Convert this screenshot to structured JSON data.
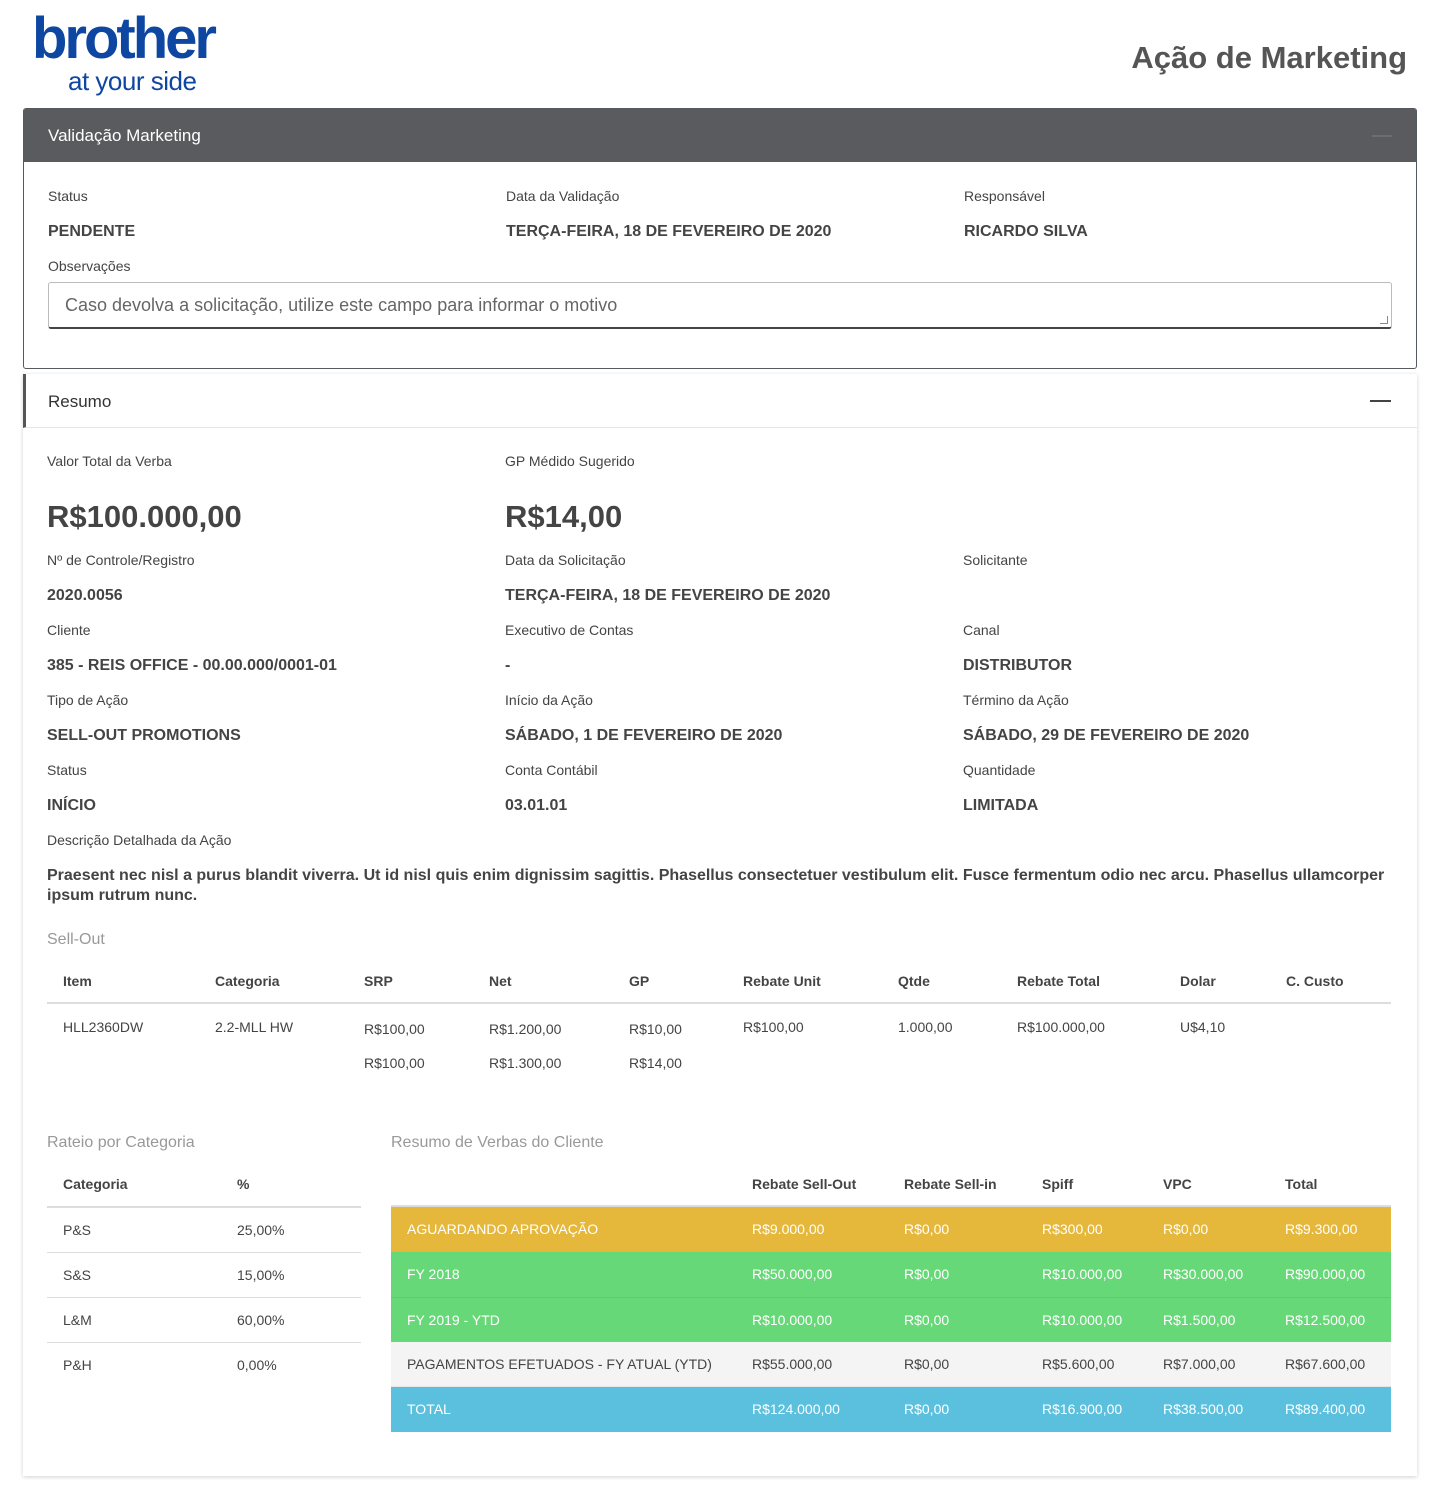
{
  "header": {
    "logo_word": "brother",
    "logo_tagline": "at your side",
    "page_title": "Ação de Marketing",
    "brand_color": "#0d47a1"
  },
  "validation": {
    "title": "Validação Marketing",
    "status_label": "Status",
    "status_value": "PENDENTE",
    "date_label": "Data da Validação",
    "date_value": "TERÇA-FEIRA, 18 DE FEVEREIRO DE 2020",
    "responsible_label": "Responsável",
    "responsible_value": "RICARDO SILVA",
    "notes_label": "Observações",
    "notes_placeholder": "Caso devolva a solicitação, utilize este campo para informar o motivo",
    "notes_value": ""
  },
  "summary": {
    "title": "Resumo",
    "total_label": "Valor Total da Verba",
    "total_value": "R$100.000,00",
    "gp_label": "GP Médido Sugerido",
    "gp_value": "R$14,00",
    "control_label": "Nº de Controle/Registro",
    "control_value": "2020.0056",
    "request_date_label": "Data da Solicitação",
    "request_date_value": "TERÇA-FEIRA, 18 DE FEVEREIRO DE 2020",
    "requester_label": "Solicitante",
    "requester_value": "",
    "client_label": "Cliente",
    "client_value": "385 - REIS OFFICE - 00.00.000/0001-01",
    "exec_label": "Executivo de Contas",
    "exec_value": "-",
    "channel_label": "Canal",
    "channel_value": "DISTRIBUTOR",
    "action_type_label": "Tipo de Ação",
    "action_type_value": "SELL-OUT PROMOTIONS",
    "start_label": "Início da Ação",
    "start_value": "SÁBADO, 1 DE FEVEREIRO DE 2020",
    "end_label": "Término da Ação",
    "end_value": "SÁBADO, 29 DE FEVEREIRO DE 2020",
    "status_label": "Status",
    "status_value": "INÍCIO",
    "account_label": "Conta Contábil",
    "account_value": "03.01.01",
    "quantity_label": "Quantidade",
    "quantity_value": "LIMITADA",
    "description_label": "Descrição Detalhada da Ação",
    "description_value": "Praesent nec nisl a purus blandit viverra. Ut id nisl quis enim dignissim sagittis. Phasellus consectetuer vestibulum elit. Fusce fermentum odio nec arcu. Phasellus ullamcorper ipsum rutrum nunc."
  },
  "sellout": {
    "title": "Sell-Out",
    "headers": [
      "Item",
      "Categoria",
      "SRP",
      "Net",
      "GP",
      "Rebate Unit",
      "Qtde",
      "Rebate Total",
      "Dolar",
      "C. Custo"
    ],
    "row": {
      "item": "HLL2360DW",
      "categoria": "2.2-MLL HW",
      "srp": [
        "R$100,00",
        "R$100,00"
      ],
      "net": [
        "R$1.200,00",
        "R$1.300,00"
      ],
      "gp": [
        "R$10,00",
        "R$14,00"
      ],
      "rebate_unit": "R$100,00",
      "qtde": "1.000,00",
      "rebate_total": "R$100.000,00",
      "dolar": "U$4,10",
      "c_custo": ""
    }
  },
  "rateio": {
    "title": "Rateio por Categoria",
    "headers": [
      "Categoria",
      "%"
    ],
    "rows": [
      {
        "categoria": "P&S",
        "pct": "25,00%"
      },
      {
        "categoria": "S&S",
        "pct": "15,00%"
      },
      {
        "categoria": "L&M",
        "pct": "60,00%"
      },
      {
        "categoria": "P&H",
        "pct": "0,00%"
      }
    ]
  },
  "verbas": {
    "title": "Resumo de Verbas do Cliente",
    "headers": [
      "",
      "Rebate Sell-Out",
      "Rebate Sell-in",
      "Spiff",
      "VPC",
      "Total"
    ],
    "rows": [
      {
        "label": "AGUARDANDO APROVAÇÃO",
        "sellout": "R$9.000,00",
        "sellin": "R$0,00",
        "spiff": "R$300,00",
        "vpc": "R$0,00",
        "total": "R$9.300,00",
        "color": "#e5b73b"
      },
      {
        "label": "FY 2018",
        "sellout": "R$50.000,00",
        "sellin": "R$0,00",
        "spiff": "R$10.000,00",
        "vpc": "R$30.000,00",
        "total": "R$90.000,00",
        "color": "#66d877"
      },
      {
        "label": "FY 2019 - YTD",
        "sellout": "R$10.000,00",
        "sellin": "R$0,00",
        "spiff": "R$10.000,00",
        "vpc": "R$1.500,00",
        "total": "R$12.500,00",
        "color": "#66d877"
      },
      {
        "label": "PAGAMENTOS EFETUADOS - FY ATUAL (YTD)",
        "sellout": "R$55.000,00",
        "sellin": "R$0,00",
        "spiff": "R$5.600,00",
        "vpc": "R$7.000,00",
        "total": "R$67.600,00",
        "color": "#f4f4f4"
      },
      {
        "label": "TOTAL",
        "sellout": "R$124.000,00",
        "sellin": "R$0,00",
        "spiff": "R$16.900,00",
        "vpc": "R$38.500,00",
        "total": "R$89.400,00",
        "color": "#5bc0de"
      }
    ]
  }
}
